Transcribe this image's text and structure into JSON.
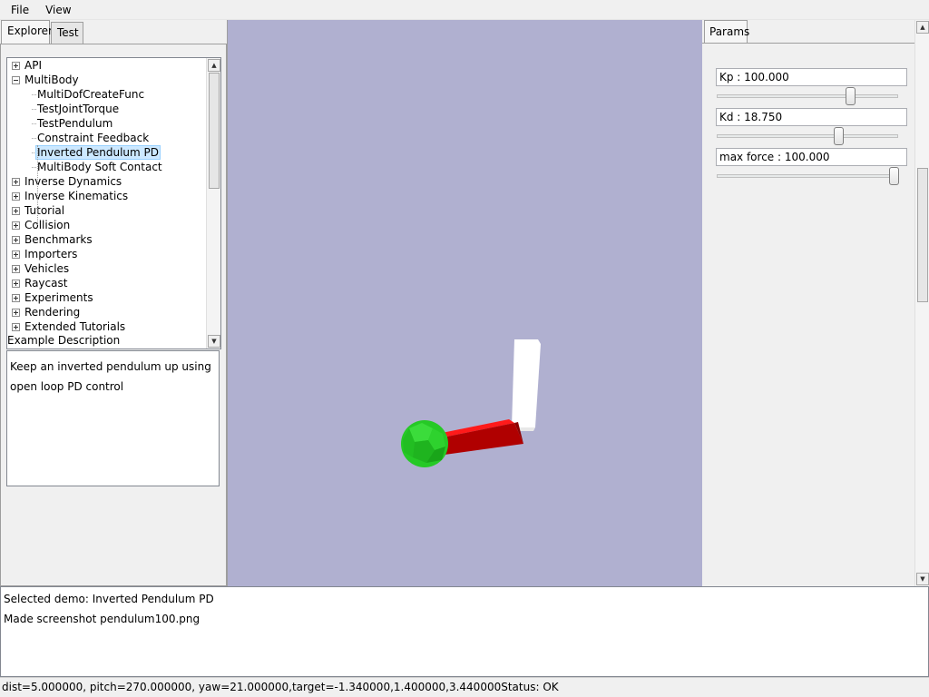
{
  "menubar": {
    "items": [
      "File",
      "View"
    ]
  },
  "left_panel": {
    "tabs": [
      "Explorer",
      "Test"
    ],
    "tree": [
      {
        "label": "API",
        "expander": "plus",
        "level": 0
      },
      {
        "label": "MultiBody",
        "expander": "minus",
        "level": 0
      },
      {
        "label": "MultiDofCreateFunc",
        "level": 1
      },
      {
        "label": "TestJointTorque",
        "level": 1
      },
      {
        "label": "TestPendulum",
        "level": 1
      },
      {
        "label": "Constraint Feedback",
        "level": 1
      },
      {
        "label": "Inverted Pendulum PD",
        "level": 1,
        "selected": true
      },
      {
        "label": "MultiBody Soft Contact",
        "level": 1
      },
      {
        "label": "Inverse Dynamics",
        "expander": "plus",
        "level": 0
      },
      {
        "label": "Inverse Kinematics",
        "expander": "plus",
        "level": 0
      },
      {
        "label": "Tutorial",
        "expander": "plus",
        "level": 0
      },
      {
        "label": "Collision",
        "expander": "plus",
        "level": 0
      },
      {
        "label": "Benchmarks",
        "expander": "plus",
        "level": 0
      },
      {
        "label": "Importers",
        "expander": "plus",
        "level": 0
      },
      {
        "label": "Vehicles",
        "expander": "plus",
        "level": 0
      },
      {
        "label": "Raycast",
        "expander": "plus",
        "level": 0
      },
      {
        "label": "Experiments",
        "expander": "plus",
        "level": 0
      },
      {
        "label": "Rendering",
        "expander": "plus",
        "level": 0
      },
      {
        "label": "Extended Tutorials",
        "expander": "plus",
        "level": 0
      }
    ],
    "description_label": "Example Description",
    "description_lines": [
      "Keep an inverted pendulum up using",
      "open loop PD control"
    ]
  },
  "right_panel": {
    "tab": "Params",
    "params": [
      {
        "label": "Kp : 100.000",
        "slider_fraction": 0.74
      },
      {
        "label": "Kd : 18.750",
        "slider_fraction": 0.675
      },
      {
        "label": "max force : 100.000",
        "slider_fraction": 0.98
      }
    ]
  },
  "log": {
    "lines": [
      "Selected demo: Inverted Pendulum PD",
      "Made screenshot pendulum100.png"
    ]
  },
  "status": {
    "text": "dist=5.000000, pitch=270.000000, yaw=21.000000,target=-1.340000,1.400000,3.440000Status: OK"
  },
  "colors": {
    "viewport_bg": "#b0b0d0",
    "sphere": "#22c522",
    "link": "#cc0000",
    "pole": "#ffffff",
    "selection": "#cce8ff"
  }
}
